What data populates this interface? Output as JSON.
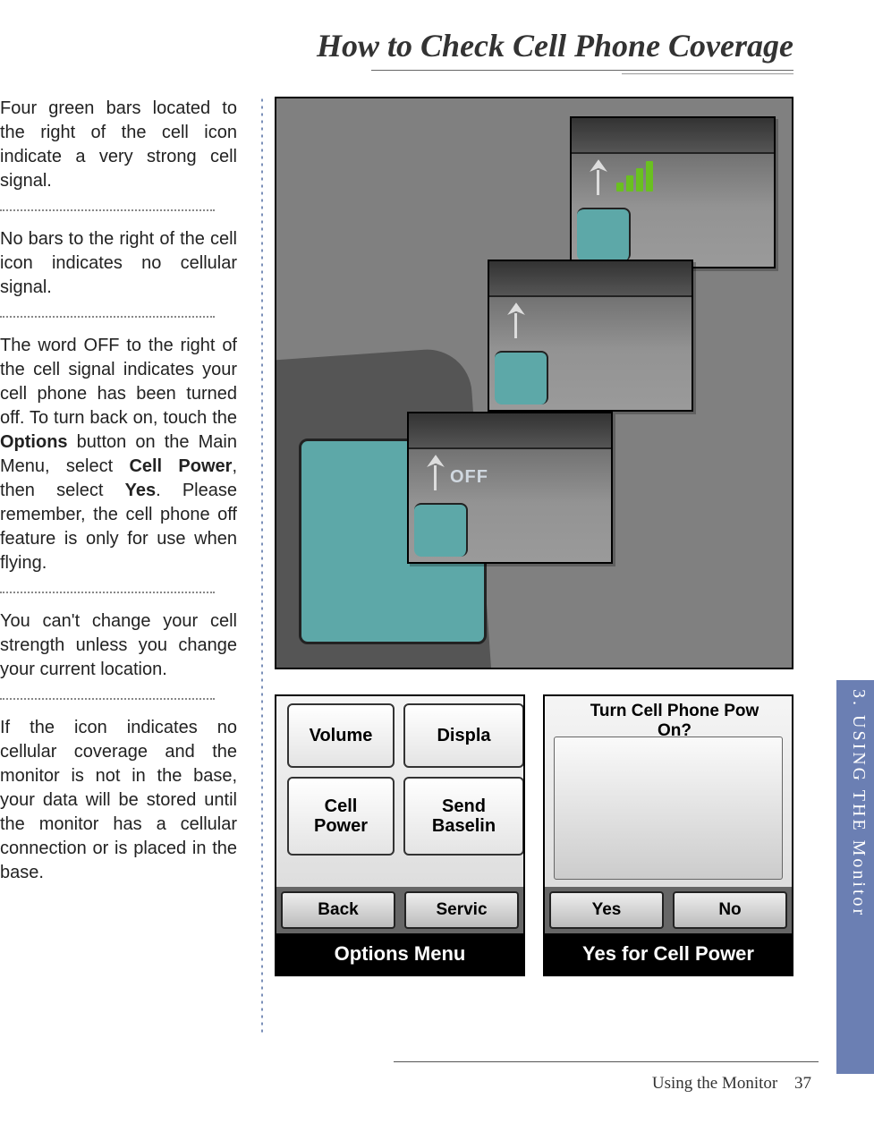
{
  "title": "How to Check Cell Phone Coverage",
  "paragraphs": {
    "p1": "Four green bars located to the right of the cell icon indicate a very strong cell signal.",
    "p2": "No bars to the right of the cell icon indicates no cellular signal.",
    "p3a": "The word OFF to the right of the cell signal indicates your cell phone has been turned off. To turn back on, touch the ",
    "p3b": "Options",
    "p3c": " button on the Main Menu, select ",
    "p3d": "Cell Power",
    "p3e": ", then select ",
    "p3f": "Yes",
    "p3g": ". Please remember, the cell phone off feature is only for use when flying.",
    "p4": "You can't change your cell strength unless you change your current location.",
    "p5": "If the icon indicates no cellular coverage and the monitor is not in the base, your data will be stored until the monitor has a cellular connection or is placed in the base."
  },
  "mini3_label": "OFF",
  "options_menu": {
    "caption": "Options Menu",
    "buttons": {
      "volume": "Volume",
      "display": "Displa",
      "cell_power": "Cell\nPower",
      "send_baseline": "Send\nBaselin",
      "back": "Back",
      "service": "Servic"
    }
  },
  "cell_power_prompt": {
    "caption": "Yes for Cell Power",
    "title": "Turn Cell Phone Pow\nOn?",
    "yes": "Yes",
    "no": "No"
  },
  "tab_label": "3. USING THE Monitor",
  "footer_section": "Using the Monitor",
  "footer_page": "37"
}
